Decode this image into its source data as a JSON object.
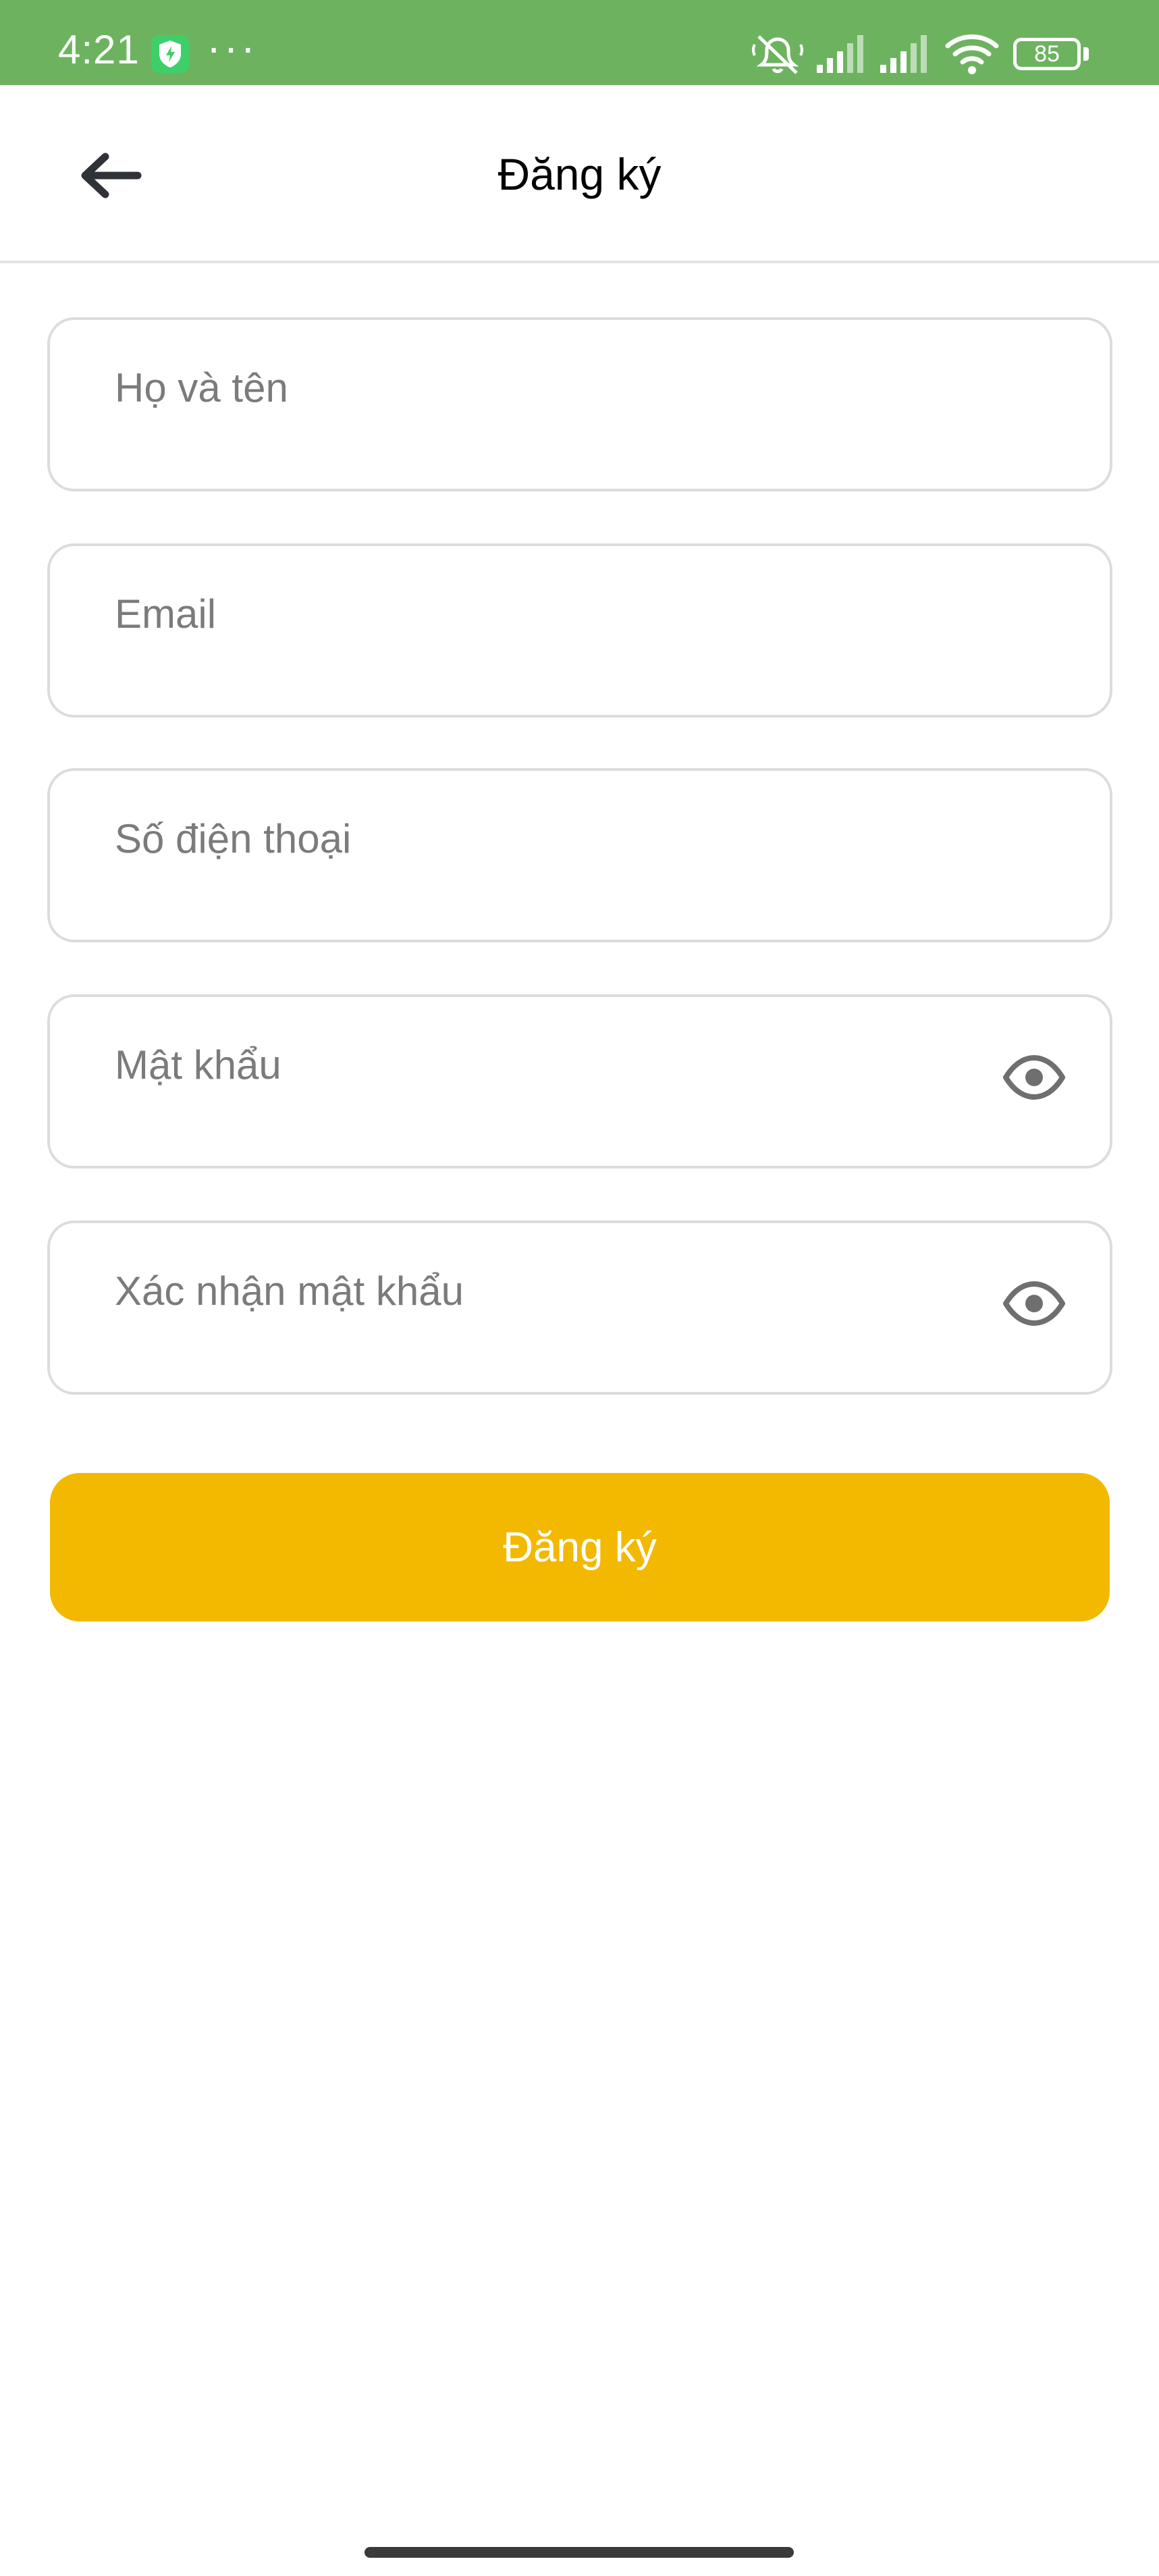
{
  "status_bar": {
    "time": "4:21",
    "dots": "···",
    "battery_level": "85",
    "background_color": "#6db35f",
    "icons": [
      "shield-icon",
      "mute-icon",
      "signal-icon",
      "signal-icon",
      "wifi-icon",
      "battery-icon"
    ]
  },
  "app_bar": {
    "title": "Đăng ký",
    "back_icon": "arrow-left-icon"
  },
  "form": {
    "full_name": {
      "placeholder": "Họ và tên",
      "value": ""
    },
    "email": {
      "placeholder": "Email",
      "value": ""
    },
    "phone": {
      "placeholder": "Số điện thoại",
      "value": ""
    },
    "password": {
      "placeholder": "Mật khẩu",
      "value": "",
      "toggle_icon": "eye-icon"
    },
    "confirm_password": {
      "placeholder": "Xác nhận mật khẩu",
      "value": "",
      "toggle_icon": "eye-icon"
    },
    "submit_label": "Đăng ký"
  },
  "colors": {
    "accent": "#f2b900",
    "field_border": "#dcdcdc",
    "placeholder": "#7b7b7b"
  }
}
